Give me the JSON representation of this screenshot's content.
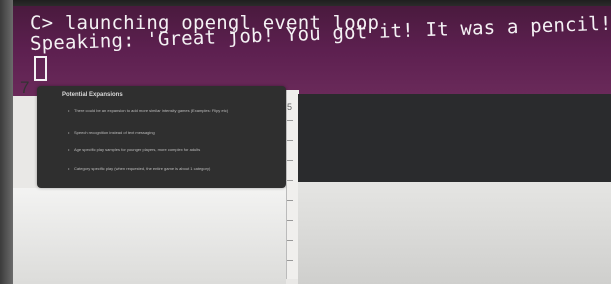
{
  "terminal": {
    "line1": "C> launching opengl event loop",
    "line2": "Speaking: 'Great job! You got it! It was a pencil!'"
  },
  "editor": {
    "line_number": "7",
    "ruler_number": "5",
    "panel": {
      "title": "Potential Expansions",
      "bullets": [
        "There could be an expansion to add more similar intensity games (Examples: Flipy etc)",
        "Speech recognition instead of text messaging",
        "Age specific play samples for younger players, more complex for adults",
        "Category specific play (when requested, the entire game is about 1 category)"
      ]
    }
  }
}
